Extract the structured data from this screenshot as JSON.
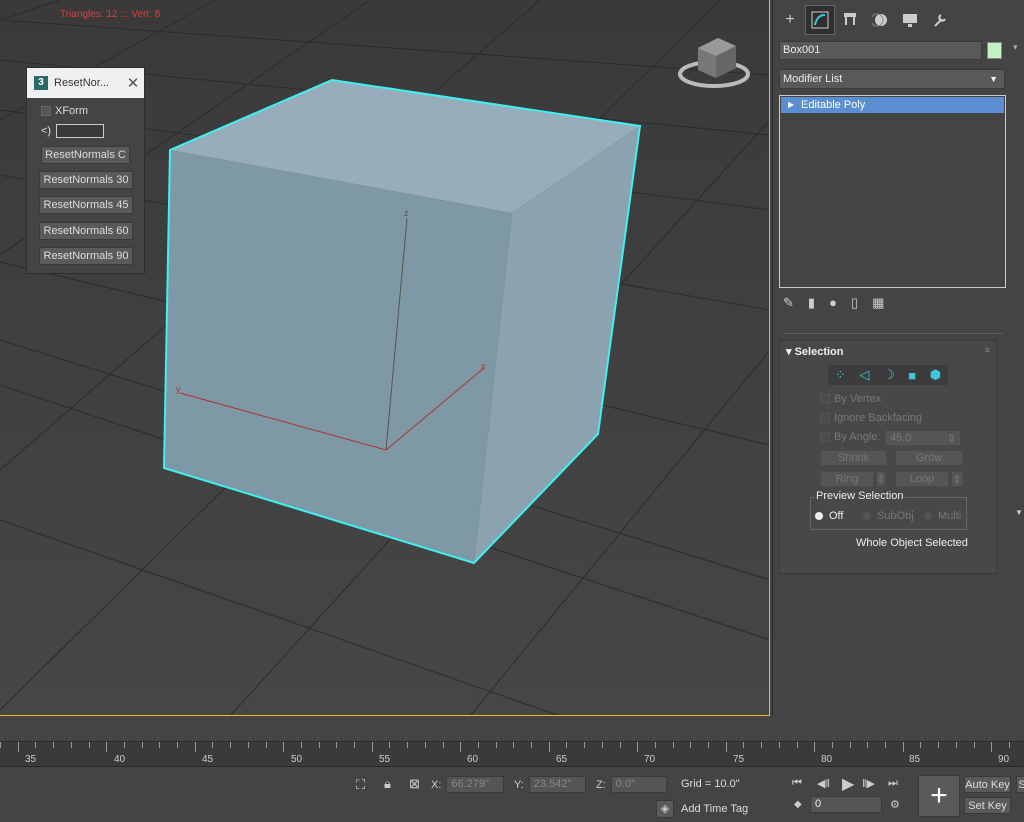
{
  "viewport": {
    "stats": "Triangles: 12 ::: Vert: 8",
    "axis_labels": {
      "z": "z",
      "x": "x",
      "y": "y"
    }
  },
  "dialog": {
    "title": "ResetNor...",
    "close": "✕",
    "xform_label": "XForm",
    "input_prefix": "<)",
    "buttons": [
      "ResetNormals C",
      "ResetNormals 30",
      "ResetNormals 45",
      "ResetNormals 60",
      "ResetNormals 90"
    ]
  },
  "right_panel": {
    "object_name": "Box001",
    "object_color": "#c4f0c4",
    "modifier_list": "Modifier List",
    "stack_item": "Editable Poly",
    "selection_header": "Selection",
    "by_vertex": "By Vertex",
    "ignore_backfacing": "Ignore Backfacing",
    "by_angle": "By Angle:",
    "angle_value": "45.0",
    "shrink": "Shrink",
    "grow": "Grow",
    "ring": "Ring",
    "loop": "Loop",
    "preview_selection": "Preview Selection",
    "off": "Off",
    "subobj": "SubObj",
    "multi": "Multi",
    "status": "Whole Object Selected"
  },
  "timeline": {
    "ticks": [
      "35",
      "40",
      "45",
      "50",
      "55",
      "60",
      "65",
      "70",
      "75",
      "80",
      "85",
      "90"
    ]
  },
  "status_bar": {
    "x_label": "X:",
    "x_value": "66.279\"",
    "y_label": "Y:",
    "y_value": "23.542\"",
    "z_label": "Z:",
    "z_value": "0.0\"",
    "grid": "Grid = 10.0\"",
    "add_time_tag": "Add Time Tag",
    "frame": "0",
    "auto_key": "Auto Key",
    "set_key": "Set Key",
    "s_partial": "S"
  }
}
